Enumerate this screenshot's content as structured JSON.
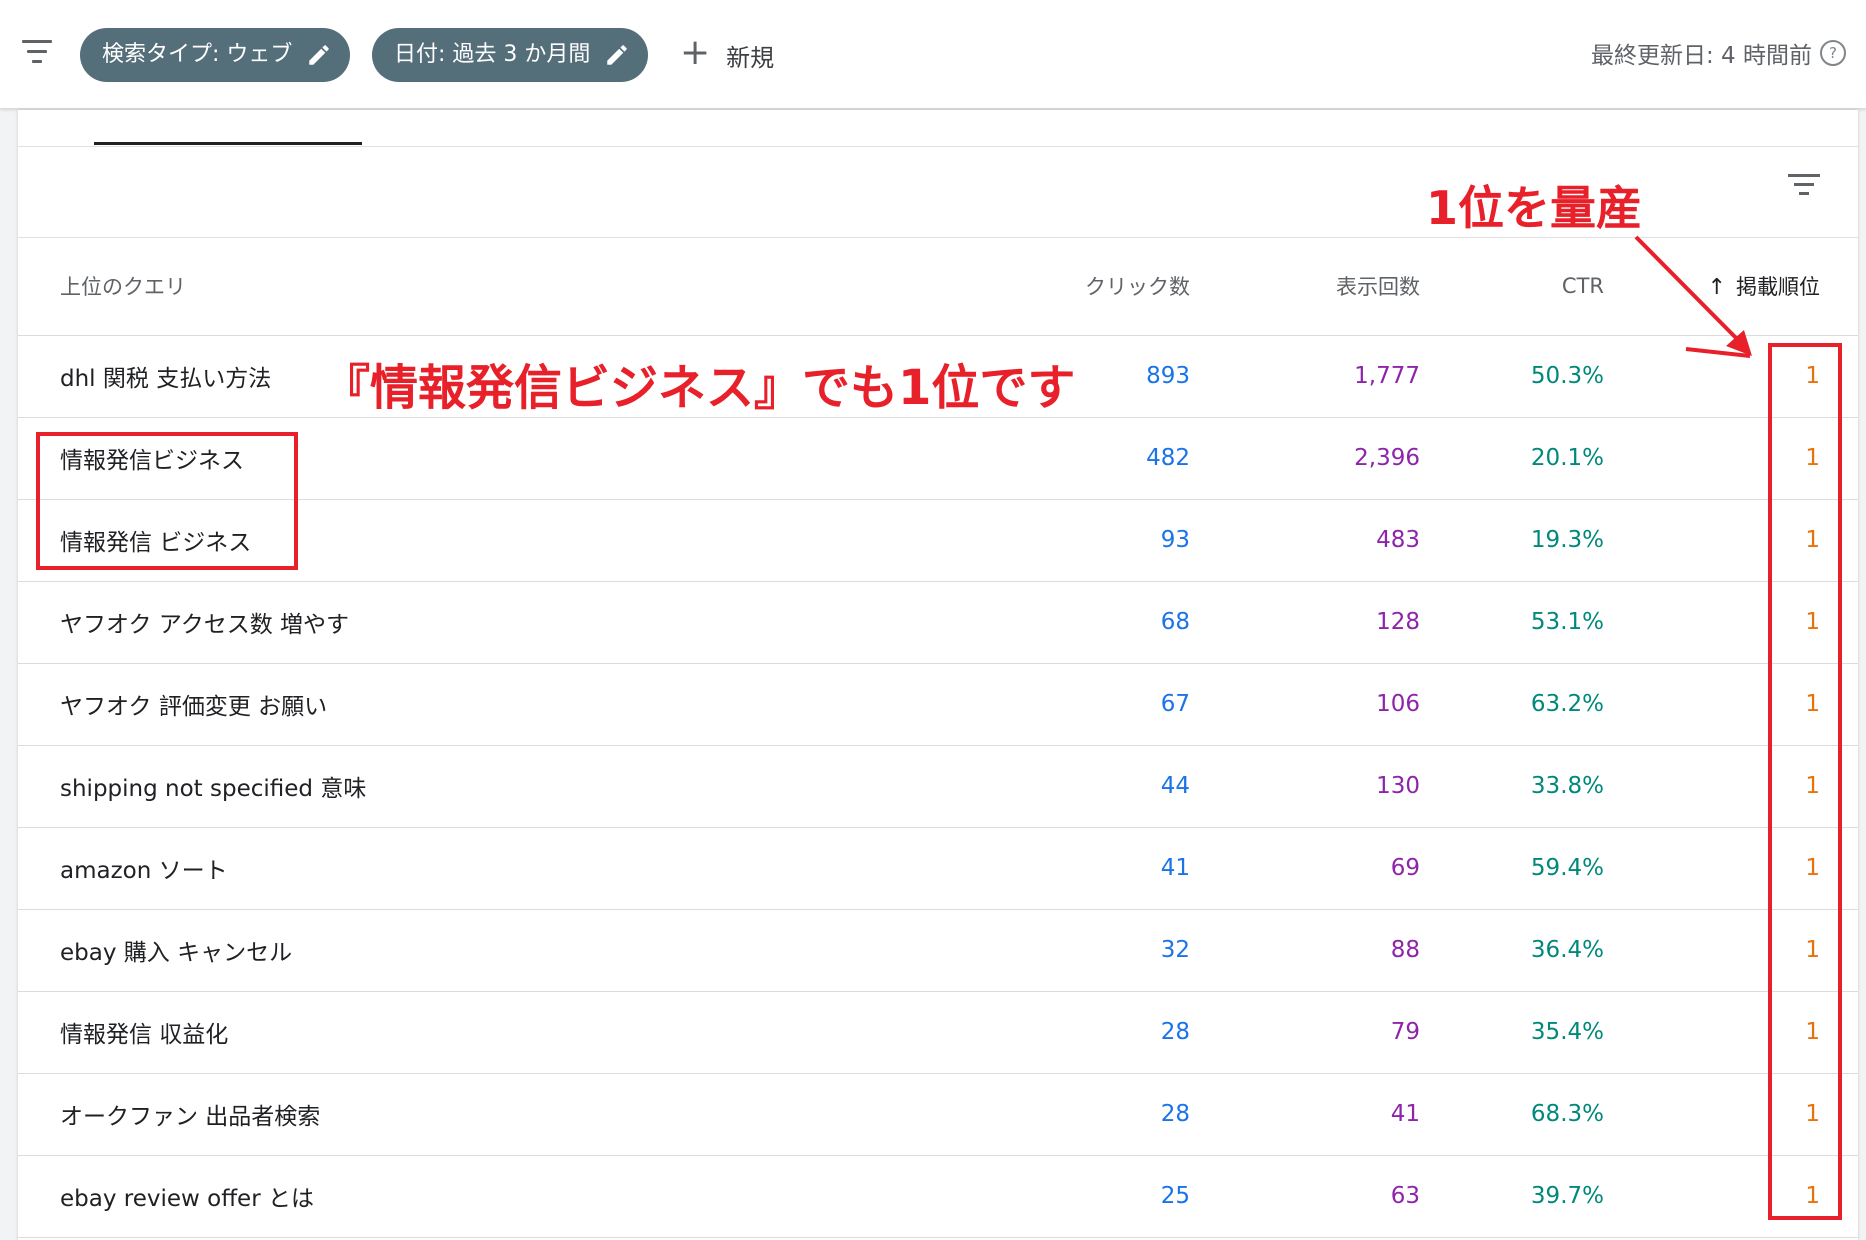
{
  "toolbar": {
    "chip_search_type": "検索タイプ: ウェブ",
    "chip_date": "日付: 過去 3 か月間",
    "new_label": "新規",
    "last_updated": "最終更新日: 4 時間前",
    "help_icon": "?"
  },
  "table": {
    "headers": {
      "query": "上位のクエリ",
      "clicks": "クリック数",
      "impressions": "表示回数",
      "ctr": "CTR",
      "position": "掲載順位",
      "sort_arrow": "↑"
    },
    "rows": [
      {
        "query": "dhl 関税 支払い方法",
        "clicks": "893",
        "impressions": "1,777",
        "ctr": "50.3%",
        "position": "1"
      },
      {
        "query": "情報発信ビジネス",
        "clicks": "482",
        "impressions": "2,396",
        "ctr": "20.1%",
        "position": "1"
      },
      {
        "query": "情報発信 ビジネス",
        "clicks": "93",
        "impressions": "483",
        "ctr": "19.3%",
        "position": "1"
      },
      {
        "query": "ヤフオク アクセス数 増やす",
        "clicks": "68",
        "impressions": "128",
        "ctr": "53.1%",
        "position": "1"
      },
      {
        "query": "ヤフオク 評価変更 お願い",
        "clicks": "67",
        "impressions": "106",
        "ctr": "63.2%",
        "position": "1"
      },
      {
        "query": "shipping not specified 意味",
        "clicks": "44",
        "impressions": "130",
        "ctr": "33.8%",
        "position": "1"
      },
      {
        "query": "amazon ソート",
        "clicks": "41",
        "impressions": "69",
        "ctr": "59.4%",
        "position": "1"
      },
      {
        "query": "ebay 購入 キャンセル",
        "clicks": "32",
        "impressions": "88",
        "ctr": "36.4%",
        "position": "1"
      },
      {
        "query": "情報発信 収益化",
        "clicks": "28",
        "impressions": "79",
        "ctr": "35.4%",
        "position": "1"
      },
      {
        "query": "オークファン 出品者検索",
        "clicks": "28",
        "impressions": "41",
        "ctr": "68.3%",
        "position": "1"
      },
      {
        "query": "ebay review offer とは",
        "clicks": "25",
        "impressions": "63",
        "ctr": "39.7%",
        "position": "1"
      }
    ]
  },
  "annotations": {
    "top_label": "1位を量産",
    "middle_label": "『情報発信ビジネス』でも1位です"
  },
  "colors": {
    "clicks": "#1a73e8",
    "impressions": "#8e24aa",
    "ctr": "#00897b",
    "position": "#e8710a",
    "annotation": "#e8202a",
    "chip": "#546e7a"
  }
}
